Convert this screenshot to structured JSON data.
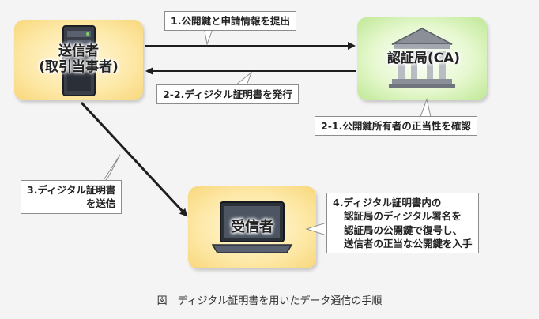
{
  "nodes": {
    "sender": {
      "line1": "送信者",
      "line2": "(取引当事者)"
    },
    "ca": {
      "label": "認証局(CA)"
    },
    "receiver": {
      "label": "受信者"
    }
  },
  "steps": {
    "s1": "1.公開鍵と申請情報を提出",
    "s2_2": "2-2.ディジタル証明書を発行",
    "s2_1": "2-1.公開鍵所有者の正当性を確認",
    "s3": [
      "3.ディジタル証明書",
      "を送信"
    ],
    "s4": [
      "4.ディジタル証明書内の",
      "認証局のディジタル署名を",
      "認証局の公開鍵で復号し、",
      "送信者の正当な公開鍵を入手"
    ]
  },
  "caption": "図　ディジタル証明書を用いたデータ通信の手順",
  "colors": {
    "sender_fill": "#fde8a6",
    "ca_fill": "#dff5c2",
    "receiver_fill": "#fde8a6",
    "arrow": "#1e1e1e",
    "callout_border": "#8c8c8c"
  },
  "icons": {
    "sender": "server-tower-icon",
    "ca": "bank-building-icon",
    "receiver": "laptop-icon"
  }
}
